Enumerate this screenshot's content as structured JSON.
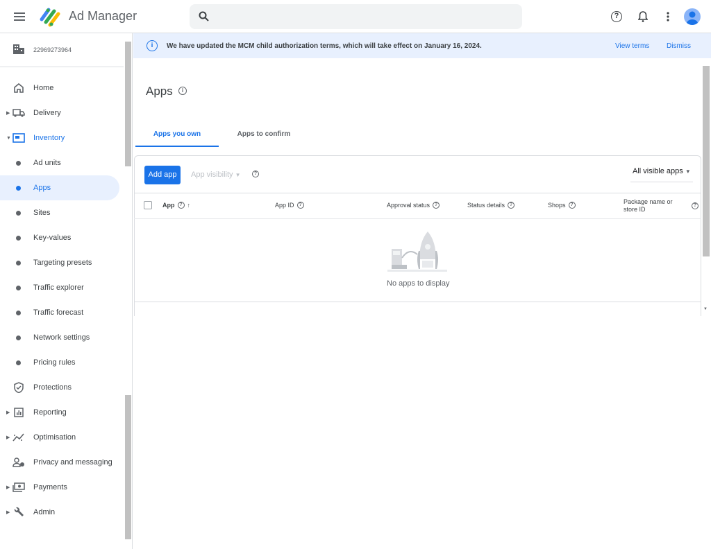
{
  "header": {
    "app_name": "Ad Manager",
    "search_placeholder": ""
  },
  "account": {
    "network_id": "22969273964"
  },
  "sidebar": {
    "items": [
      {
        "label": "Home",
        "icon": "home-icon",
        "type": "top"
      },
      {
        "label": "Delivery",
        "icon": "truck-icon",
        "type": "top",
        "expandable": true
      },
      {
        "label": "Inventory",
        "icon": "inventory-icon",
        "type": "top",
        "expandable": true,
        "expanded": true
      },
      {
        "label": "Ad units",
        "type": "sub"
      },
      {
        "label": "Apps",
        "type": "sub",
        "selected": true
      },
      {
        "label": "Sites",
        "type": "sub"
      },
      {
        "label": "Key-values",
        "type": "sub"
      },
      {
        "label": "Targeting presets",
        "type": "sub"
      },
      {
        "label": "Traffic explorer",
        "type": "sub"
      },
      {
        "label": "Traffic forecast",
        "type": "sub"
      },
      {
        "label": "Network settings",
        "type": "sub"
      },
      {
        "label": "Pricing rules",
        "type": "sub"
      },
      {
        "label": "Protections",
        "icon": "shield-icon",
        "type": "top"
      },
      {
        "label": "Reporting",
        "icon": "chart-icon",
        "type": "top",
        "expandable": true
      },
      {
        "label": "Optimisation",
        "icon": "trend-icon",
        "type": "top",
        "expandable": true
      },
      {
        "label": "Privacy and messaging",
        "icon": "person-icon",
        "type": "top"
      },
      {
        "label": "Payments",
        "icon": "money-icon",
        "type": "top",
        "expandable": true
      },
      {
        "label": "Admin",
        "icon": "wrench-icon",
        "type": "top",
        "expandable": true
      }
    ]
  },
  "banner": {
    "message": "We have updated the MCM child authorization terms, which will take effect on January 16, 2024.",
    "view_terms": "View terms",
    "dismiss": "Dismiss"
  },
  "page": {
    "title": "Apps",
    "tabs": [
      {
        "label": "Apps you own",
        "active": true
      },
      {
        "label": "Apps to confirm"
      }
    ]
  },
  "toolbar": {
    "add_app": "Add app",
    "app_visibility": "App visibility",
    "filter_value": "All visible apps"
  },
  "table": {
    "columns": [
      "App",
      "App ID",
      "Approval status",
      "Status details",
      "Shops",
      "Package name or store ID"
    ],
    "empty_message": "No apps to display"
  },
  "colors": {
    "accent": "#1a73e8",
    "banner_bg": "#e8f0fe"
  }
}
